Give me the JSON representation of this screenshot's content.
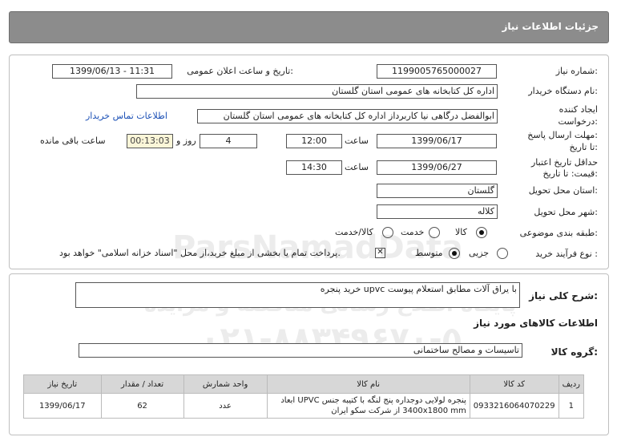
{
  "header": {
    "title": "جزئیات اطلاعات نیاز"
  },
  "form": {
    "need_number_label": "شماره نیاز:",
    "need_number": "1199005765000027",
    "announce_label": "تاریخ و ساعت اعلان عمومی:",
    "announce_value": "1399/06/13 - 11:31",
    "buyer_label": "نام دستگاه خریدار:",
    "buyer_value": "اداره کل کتابخانه های عمومی استان گلستان",
    "creator_label_1": "ایجاد کننده",
    "creator_label_2": "درخواست:",
    "creator_value": "ابوالفضل  درگاهی نیا کاربرداز اداره کل کتابخانه های عمومی استان گلستان",
    "contact_link": "اطلاعات تماس خریدار",
    "deadline_label_1": "مهلت ارسال پاسخ:",
    "deadline_label_2": "تا تاریخ:",
    "deadline_date": "1399/06/17",
    "time_label": "ساعت",
    "deadline_time": "12:00",
    "days_value": "4",
    "days_label": "روز و",
    "remaining_time": "00:13:03",
    "remaining_label": "ساعت باقی مانده",
    "validity_label_1": "حداقل تاریخ اعتبار",
    "validity_label_2": "قیمت: تا تاریخ:",
    "validity_date": "1399/06/27",
    "validity_time": "14:30",
    "province_label": "استان محل تحویل:",
    "province_value": "گلستان",
    "city_label": "شهر محل تحویل:",
    "city_value": "کلاله",
    "category_label": "طبقه بندی موضوعی:",
    "category_options": [
      "کالا",
      "خدمت",
      "کالا/خدمت"
    ],
    "process_label": "نوع فرآیند خرید :",
    "process_options": [
      "جزیی",
      "متوسط"
    ],
    "payment_note": "پرداخت تمام یا بخشی از مبلغ خرید،از محل \"اسناد خزانه اسلامی\" خواهد بود."
  },
  "details": {
    "summary_label": "شرح کلی نیاز:",
    "summary_value": "خرید پنجره upvc با یراق آلات مطابق استعلام پیوست",
    "items_title": "اطلاعات کالاهای مورد نیاز",
    "group_label": "گروه کالا:",
    "group_value": "تاسیسات و مصالح ساختمانی",
    "table": {
      "headers": [
        "ردیف",
        "کد کالا",
        "نام کالا",
        "واحد شمارش",
        "تعداد / مقدار",
        "تاریخ نیاز"
      ],
      "rows": [
        [
          "1",
          "0933216064070229",
          "پنجره لولایی دوجداره پنج لنگه با کتیبه جنس UPVC ابعاد 3400x1800 mm از شرکت سکو ایران",
          "عدد",
          "62",
          "1399/06/17"
        ]
      ]
    }
  },
  "watermark": {
    "brand": "ParsNamadData",
    "line1": "پایگاه اطلاع رسانی مناقصه و مزایده",
    "phone": "۰۲۱-۸۸۳۴۹۶۷۰-۵"
  }
}
